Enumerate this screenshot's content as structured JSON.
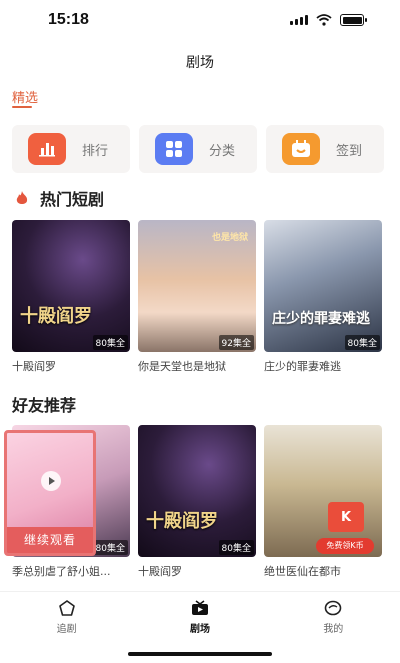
{
  "status_bar": {
    "time": "15:18"
  },
  "header": {
    "title": "剧场"
  },
  "tabs": [
    {
      "label": "精选",
      "active": true
    }
  ],
  "quick_actions": [
    {
      "label": "排行",
      "icon": "ranking-chart-icon",
      "color": "#f0603f"
    },
    {
      "label": "分类",
      "icon": "category-grid-icon",
      "color": "#5b7cf2"
    },
    {
      "label": "签到",
      "icon": "checkin-calendar-icon",
      "color": "#f59a2f"
    }
  ],
  "hot_section": {
    "title": "热门短剧",
    "icon": "flame-icon",
    "items": [
      {
        "title": "十殿阎罗",
        "episodes": "80集全",
        "poster_text": "十殿阎罗"
      },
      {
        "title": "你是天堂也是地狱",
        "episodes": "92集全",
        "poster_text": "也是地狱"
      },
      {
        "title": "庄少的罪妻难逃",
        "episodes": "80集全",
        "poster_text": "庄少的罪妻难逃"
      }
    ]
  },
  "friend_section": {
    "title": "好友推荐",
    "continue_label": "继续观看",
    "items": [
      {
        "title": "季总别虐了舒小姐...",
        "episodes": "80集全"
      },
      {
        "title": "十殿阎罗",
        "episodes": "80集全",
        "poster_text": "十殿阎罗"
      },
      {
        "title": "绝世医仙在都市",
        "coupon_text": "免费领K币"
      }
    ]
  },
  "bottom_nav": [
    {
      "label": "追剧",
      "icon": "pentagon-star-icon",
      "active": false
    },
    {
      "label": "剧场",
      "icon": "tv-icon",
      "active": true
    },
    {
      "label": "我的",
      "icon": "profile-face-icon",
      "active": false
    }
  ]
}
